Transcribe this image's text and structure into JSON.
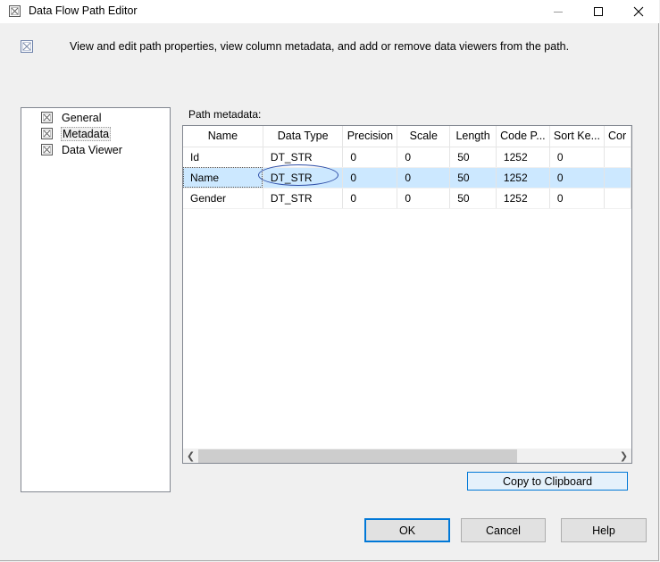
{
  "window": {
    "title": "Data Flow Path Editor",
    "icon": "dialog-icon"
  },
  "header": {
    "description": "View and edit path properties, view column metadata, and add or remove data viewers from the path."
  },
  "nav": {
    "items": [
      {
        "label": "General",
        "selected": false
      },
      {
        "label": "Metadata",
        "selected": true
      },
      {
        "label": "Data Viewer",
        "selected": false
      }
    ]
  },
  "metadata": {
    "label": "Path metadata:",
    "columns": [
      "Name",
      "Data Type",
      "Precision",
      "Scale",
      "Length",
      "Code P...",
      "Sort Ke...",
      "Cor"
    ],
    "rows": [
      [
        "Id",
        "DT_STR",
        "0",
        "0",
        "50",
        "1252",
        "0",
        ""
      ],
      [
        "Name",
        "DT_STR",
        "0",
        "0",
        "50",
        "1252",
        "0",
        ""
      ],
      [
        "Gender",
        "DT_STR",
        "0",
        "0",
        "50",
        "1252",
        "0",
        ""
      ]
    ],
    "selected_row": 1
  },
  "buttons": {
    "copy": "Copy to Clipboard",
    "ok": "OK",
    "cancel": "Cancel",
    "help": "Help"
  },
  "colors": {
    "selection": "#cce8ff",
    "accent": "#0078d7",
    "annotation": "#2f4fa8"
  }
}
